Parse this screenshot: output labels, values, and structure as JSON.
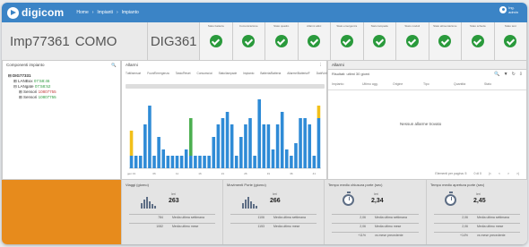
{
  "app": {
    "brand": "digicom",
    "breadcrumb": [
      "Home",
      "›",
      "Impianti",
      "›",
      "Impianto"
    ]
  },
  "user": {
    "name": "Ing.",
    "line2": "admin"
  },
  "header": {
    "plant_code": "Imp77361",
    "plant_name": "COMO",
    "device": "DIG361",
    "statuses": [
      {
        "label": "Stato batteria"
      },
      {
        "label": "Comunicazione"
      },
      {
        "label": "Stato quadro"
      },
      {
        "label": "Allarmi attivi"
      },
      {
        "label": "Stato emergenza"
      },
      {
        "label": "Stato lampade"
      },
      {
        "label": "Stato moduli"
      },
      {
        "label": "Stato alimentazione"
      },
      {
        "label": "Stato scheda"
      },
      {
        "label": "Stato test"
      }
    ],
    "status_color": "#2a9a3c"
  },
  "components": {
    "title": "Componenti impianto",
    "root": "DIG77331",
    "items": [
      {
        "label": "LANBox",
        "value": "07:58:46",
        "level": 2,
        "color": "green"
      },
      {
        "label": "LANgate",
        "value": "07:58:52",
        "level": 2,
        "color": "green"
      },
      {
        "label": "Sensori",
        "value": "10807755",
        "level": 3,
        "color": "red"
      },
      {
        "label": "Sensori",
        "value": "10807755",
        "level": 3,
        "color": "green"
      }
    ]
  },
  "chart_panel": {
    "title": "Allarmi",
    "legend": [
      "Tutti/sensori",
      "Fuori/Emergenza",
      "Tasto/Reset",
      "Consumo/ai",
      "Stato/lampade",
      "Impianto",
      "Batteria/Batteria",
      "Allarme/Batteria/F",
      "Dati/Volt"
    ]
  },
  "chart_data": {
    "type": "bar",
    "categories": [
      "gen 01",
      "02",
      "03",
      "04",
      "05",
      "06",
      "07",
      "08",
      "09",
      "10",
      "11",
      "12",
      "13",
      "14",
      "15",
      "16",
      "17",
      "18",
      "19",
      "20",
      "21",
      "22",
      "23",
      "24",
      "25",
      "26",
      "27",
      "28",
      "29",
      "30",
      "31",
      "32",
      "33",
      "34",
      "35",
      "36",
      "37",
      "38",
      "39",
      "40",
      "41",
      "42"
    ],
    "series": [
      {
        "color": "#2f8bd6",
        "values": [
          2,
          2,
          2,
          7,
          10,
          2,
          5,
          3,
          2,
          2,
          2,
          2,
          3,
          2,
          2,
          2,
          2,
          2,
          5,
          7,
          8,
          9,
          7,
          2,
          5,
          7,
          8,
          2,
          11,
          7,
          7,
          3,
          7,
          9,
          3,
          2,
          4,
          8,
          8,
          7,
          2,
          8
        ]
      },
      {
        "color": "#f2c01a",
        "values": [
          4,
          0,
          0,
          0,
          0,
          0,
          0,
          0,
          0,
          0,
          0,
          0,
          0,
          0,
          0,
          0,
          0,
          0,
          0,
          0,
          0,
          0,
          0,
          0,
          0,
          0,
          0,
          0,
          0,
          0,
          0,
          0,
          0,
          0,
          0,
          0,
          0,
          0,
          0,
          0,
          0,
          2
        ]
      },
      {
        "color": "#4caf50",
        "values": [
          0,
          0,
          0,
          0,
          0,
          0,
          0,
          0,
          0,
          0,
          0,
          0,
          0,
          6,
          0,
          0,
          0,
          0,
          0,
          0,
          0,
          0,
          0,
          0,
          0,
          0,
          0,
          0,
          0,
          0,
          0,
          0,
          0,
          0,
          0,
          0,
          0,
          0,
          0,
          0,
          0,
          0
        ]
      }
    ],
    "ylim": [
      0,
      12
    ]
  },
  "alarms": {
    "title": "Allarmi",
    "subtitle": "Risultati: ultimi 30 giorni",
    "columns": [
      "Impianto",
      "Ultimo agg.",
      "Origine",
      "Tipo",
      "Quantità",
      "Stato"
    ],
    "empty": "Nessun allarme trovato",
    "footer": [
      "Elementi per pagina: 5",
      "0 di 0",
      "|<",
      "<",
      ">",
      ">|"
    ]
  },
  "kpis": [
    {
      "title": "Viaggi (giorno)",
      "label": "Ieri",
      "value": "263",
      "rows": [
        [
          "784",
          "Media ultima settimana"
        ],
        [
          "1082",
          "Media ultimo mese"
        ]
      ]
    },
    {
      "title": "Movimenti Porte (giorno)",
      "label": "Ieri",
      "value": "266",
      "rows": [
        [
          "1106",
          "Media ultima settimana"
        ],
        [
          "1153",
          "Media ultimo mese"
        ]
      ]
    },
    {
      "title": "Tempo medio chiusura porte (sec)",
      "label": "Ieri",
      "value": "2,34",
      "rows": [
        [
          "2,06",
          "Media ultima settimana"
        ],
        [
          "2,06",
          "Media ultimo mese"
        ],
        [
          "+11%",
          "vs mese precedente"
        ]
      ]
    },
    {
      "title": "Tempo medio apertura porte (sec)",
      "label": "Ieri",
      "value": "2,45",
      "rows": [
        [
          "2,06",
          "Media ultima settimana"
        ],
        [
          "2,06",
          "Media ultimo mese"
        ],
        [
          "+14%",
          "vs mese precedente"
        ]
      ]
    }
  ]
}
